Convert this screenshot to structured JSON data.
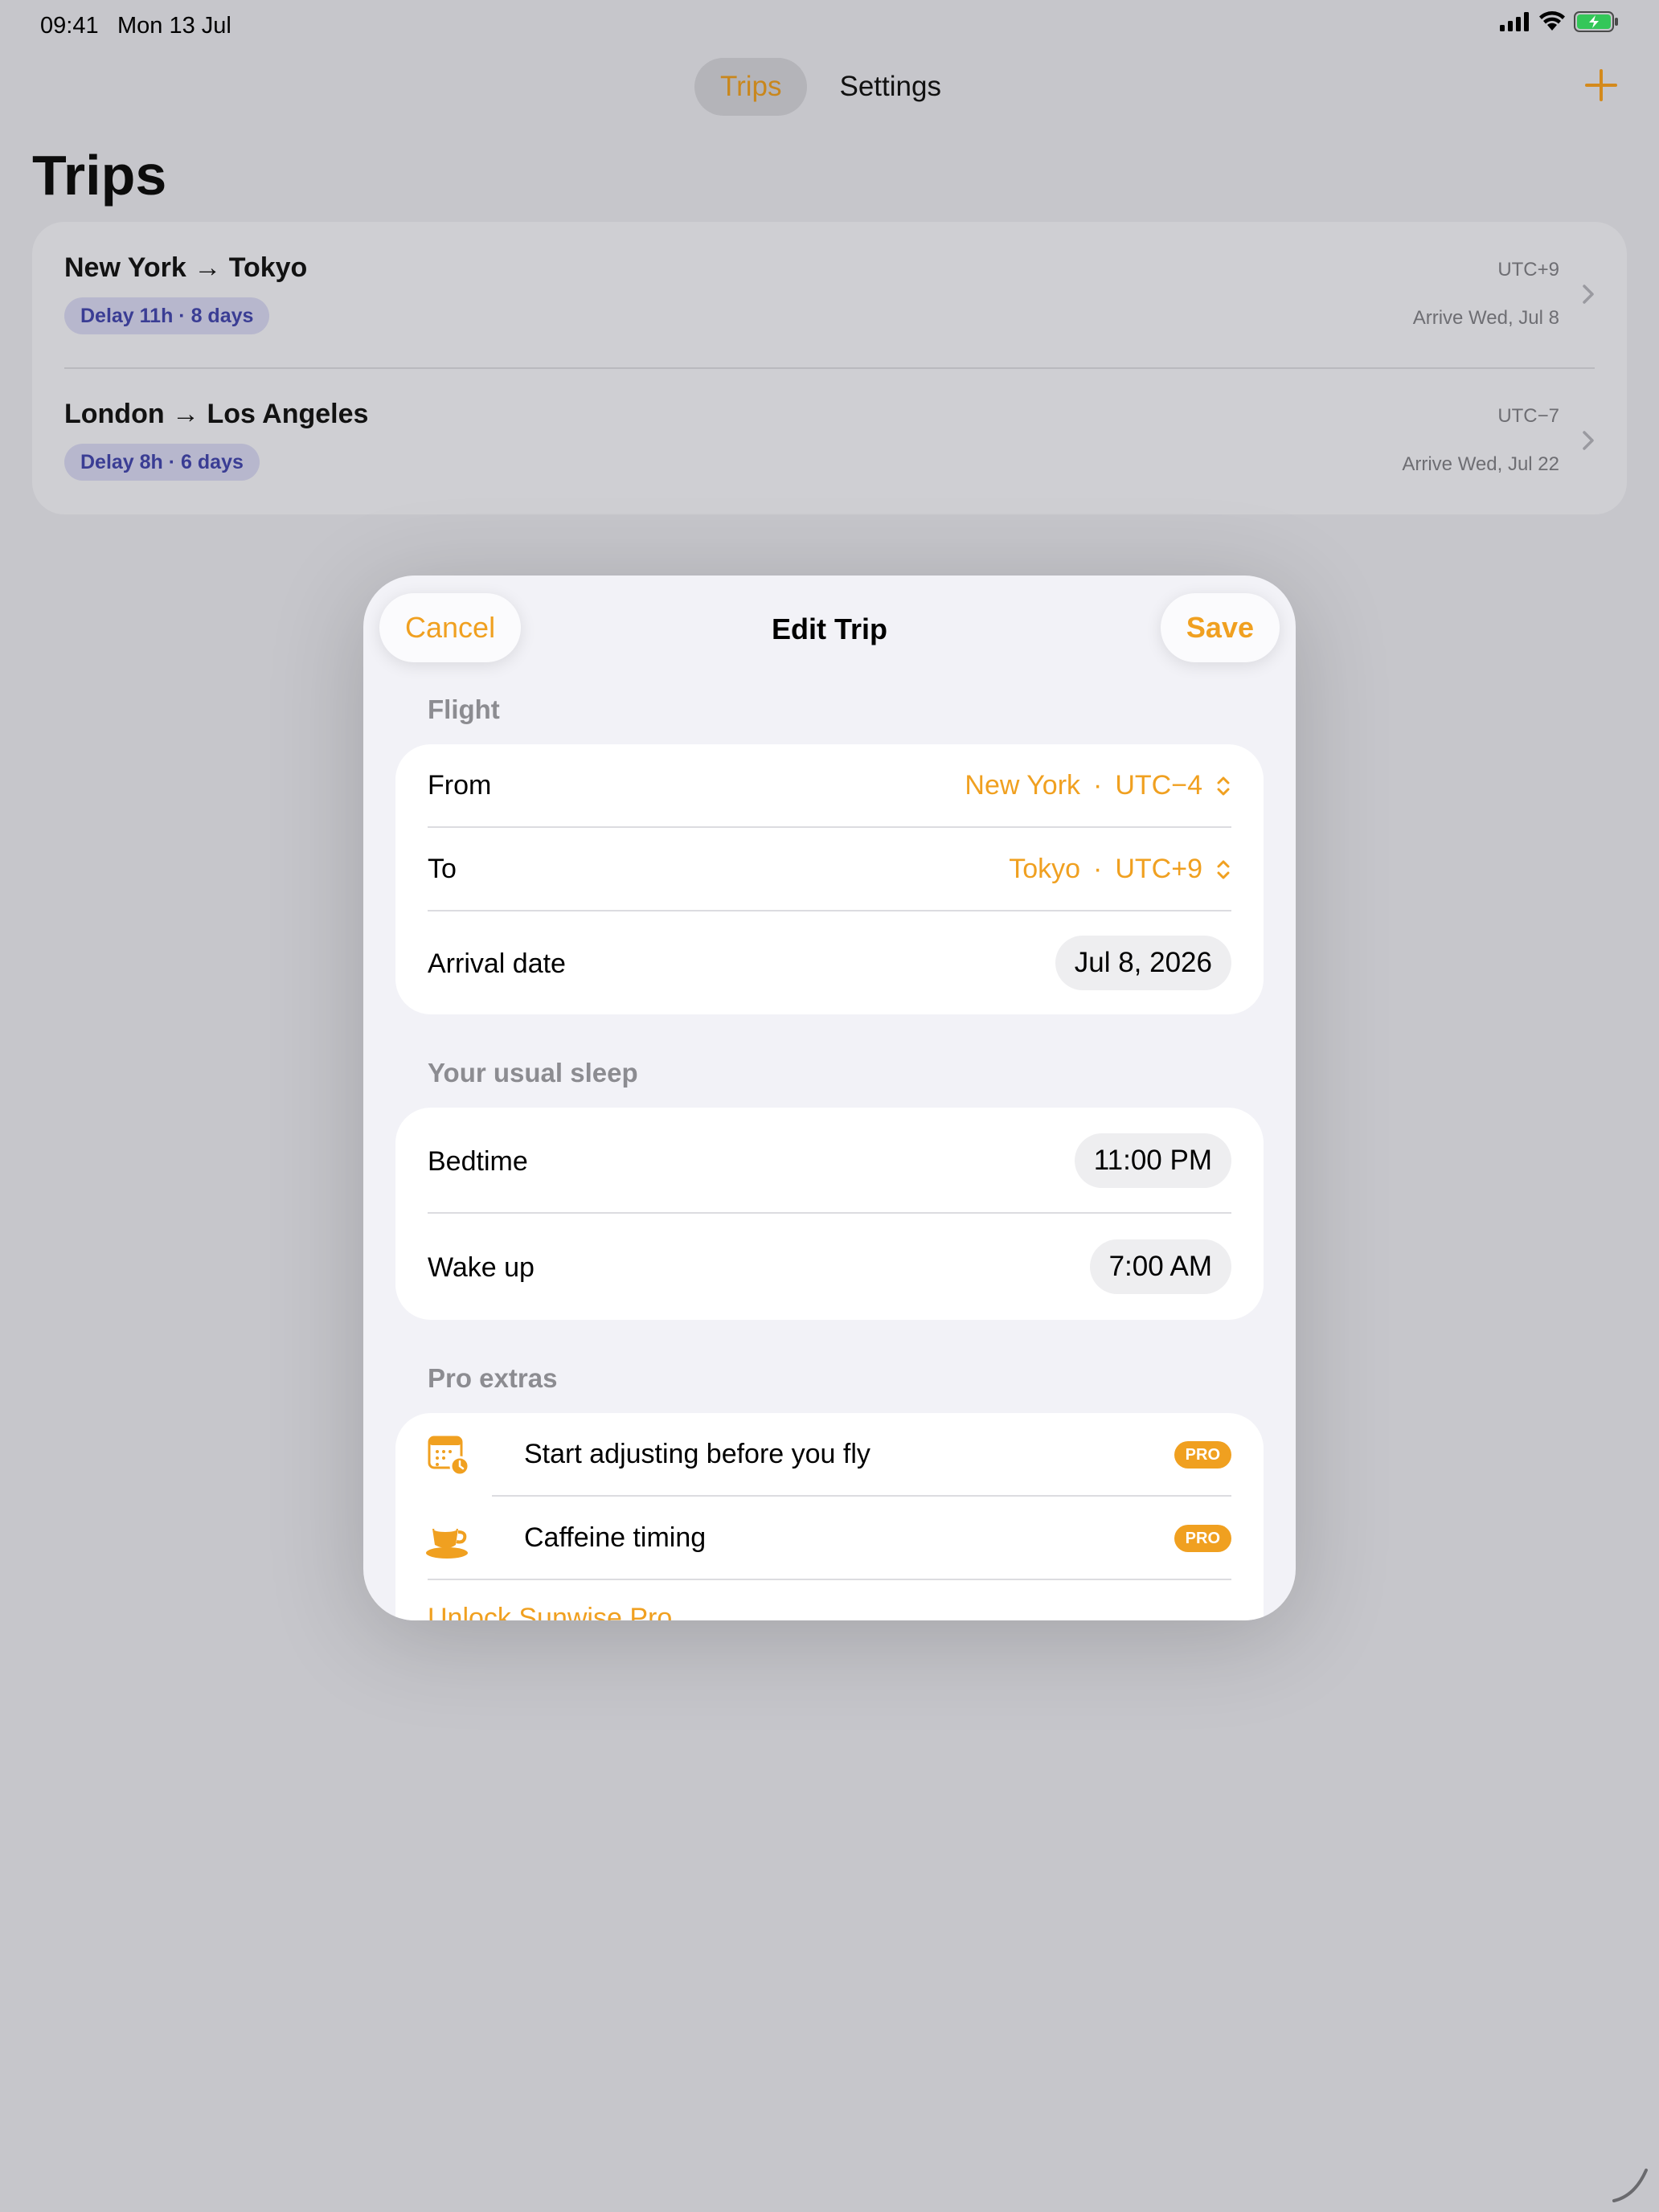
{
  "status_bar": {
    "time": "09:41",
    "date": "Mon 13 Jul"
  },
  "top_tabs": {
    "trips": "Trips",
    "settings": "Settings"
  },
  "page": {
    "title": "Trips"
  },
  "trips": [
    {
      "route": "New York → Tokyo",
      "badge": "Delay 11h · 8 days",
      "utc": "UTC+9",
      "arrive": "Arrive Wed, Jul 8"
    },
    {
      "route": "London → Los Angeles",
      "badge": "Delay 8h · 6 days",
      "utc": "UTC−7",
      "arrive": "Arrive Wed, Jul 22"
    }
  ],
  "sheet": {
    "title": "Edit Trip",
    "cancel": "Cancel",
    "save": "Save",
    "flight": {
      "section": "Flight",
      "from_label": "From",
      "from_city": "New York",
      "from_utc": "UTC−4",
      "to_label": "To",
      "to_city": "Tokyo",
      "to_utc": "UTC+9",
      "separator": "·",
      "arrival_label": "Arrival date",
      "arrival_value": "Jul 8, 2026"
    },
    "sleep": {
      "section": "Your usual sleep",
      "bedtime_label": "Bedtime",
      "bedtime_value": "11:00 PM",
      "wake_label": "Wake up",
      "wake_value": "7:00 AM"
    },
    "pro": {
      "section": "Pro extras",
      "items": [
        {
          "label": "Start adjusting before you fly",
          "badge": "PRO",
          "icon": "calendar-clock-icon"
        },
        {
          "label": "Caffeine timing",
          "badge": "PRO",
          "icon": "coffee-cup-icon"
        }
      ],
      "unlock": "Unlock Sunwise Pro"
    }
  },
  "colors": {
    "accent": "#f0a020",
    "badge_text": "#3a3d94",
    "background": "#c6c6cb"
  }
}
